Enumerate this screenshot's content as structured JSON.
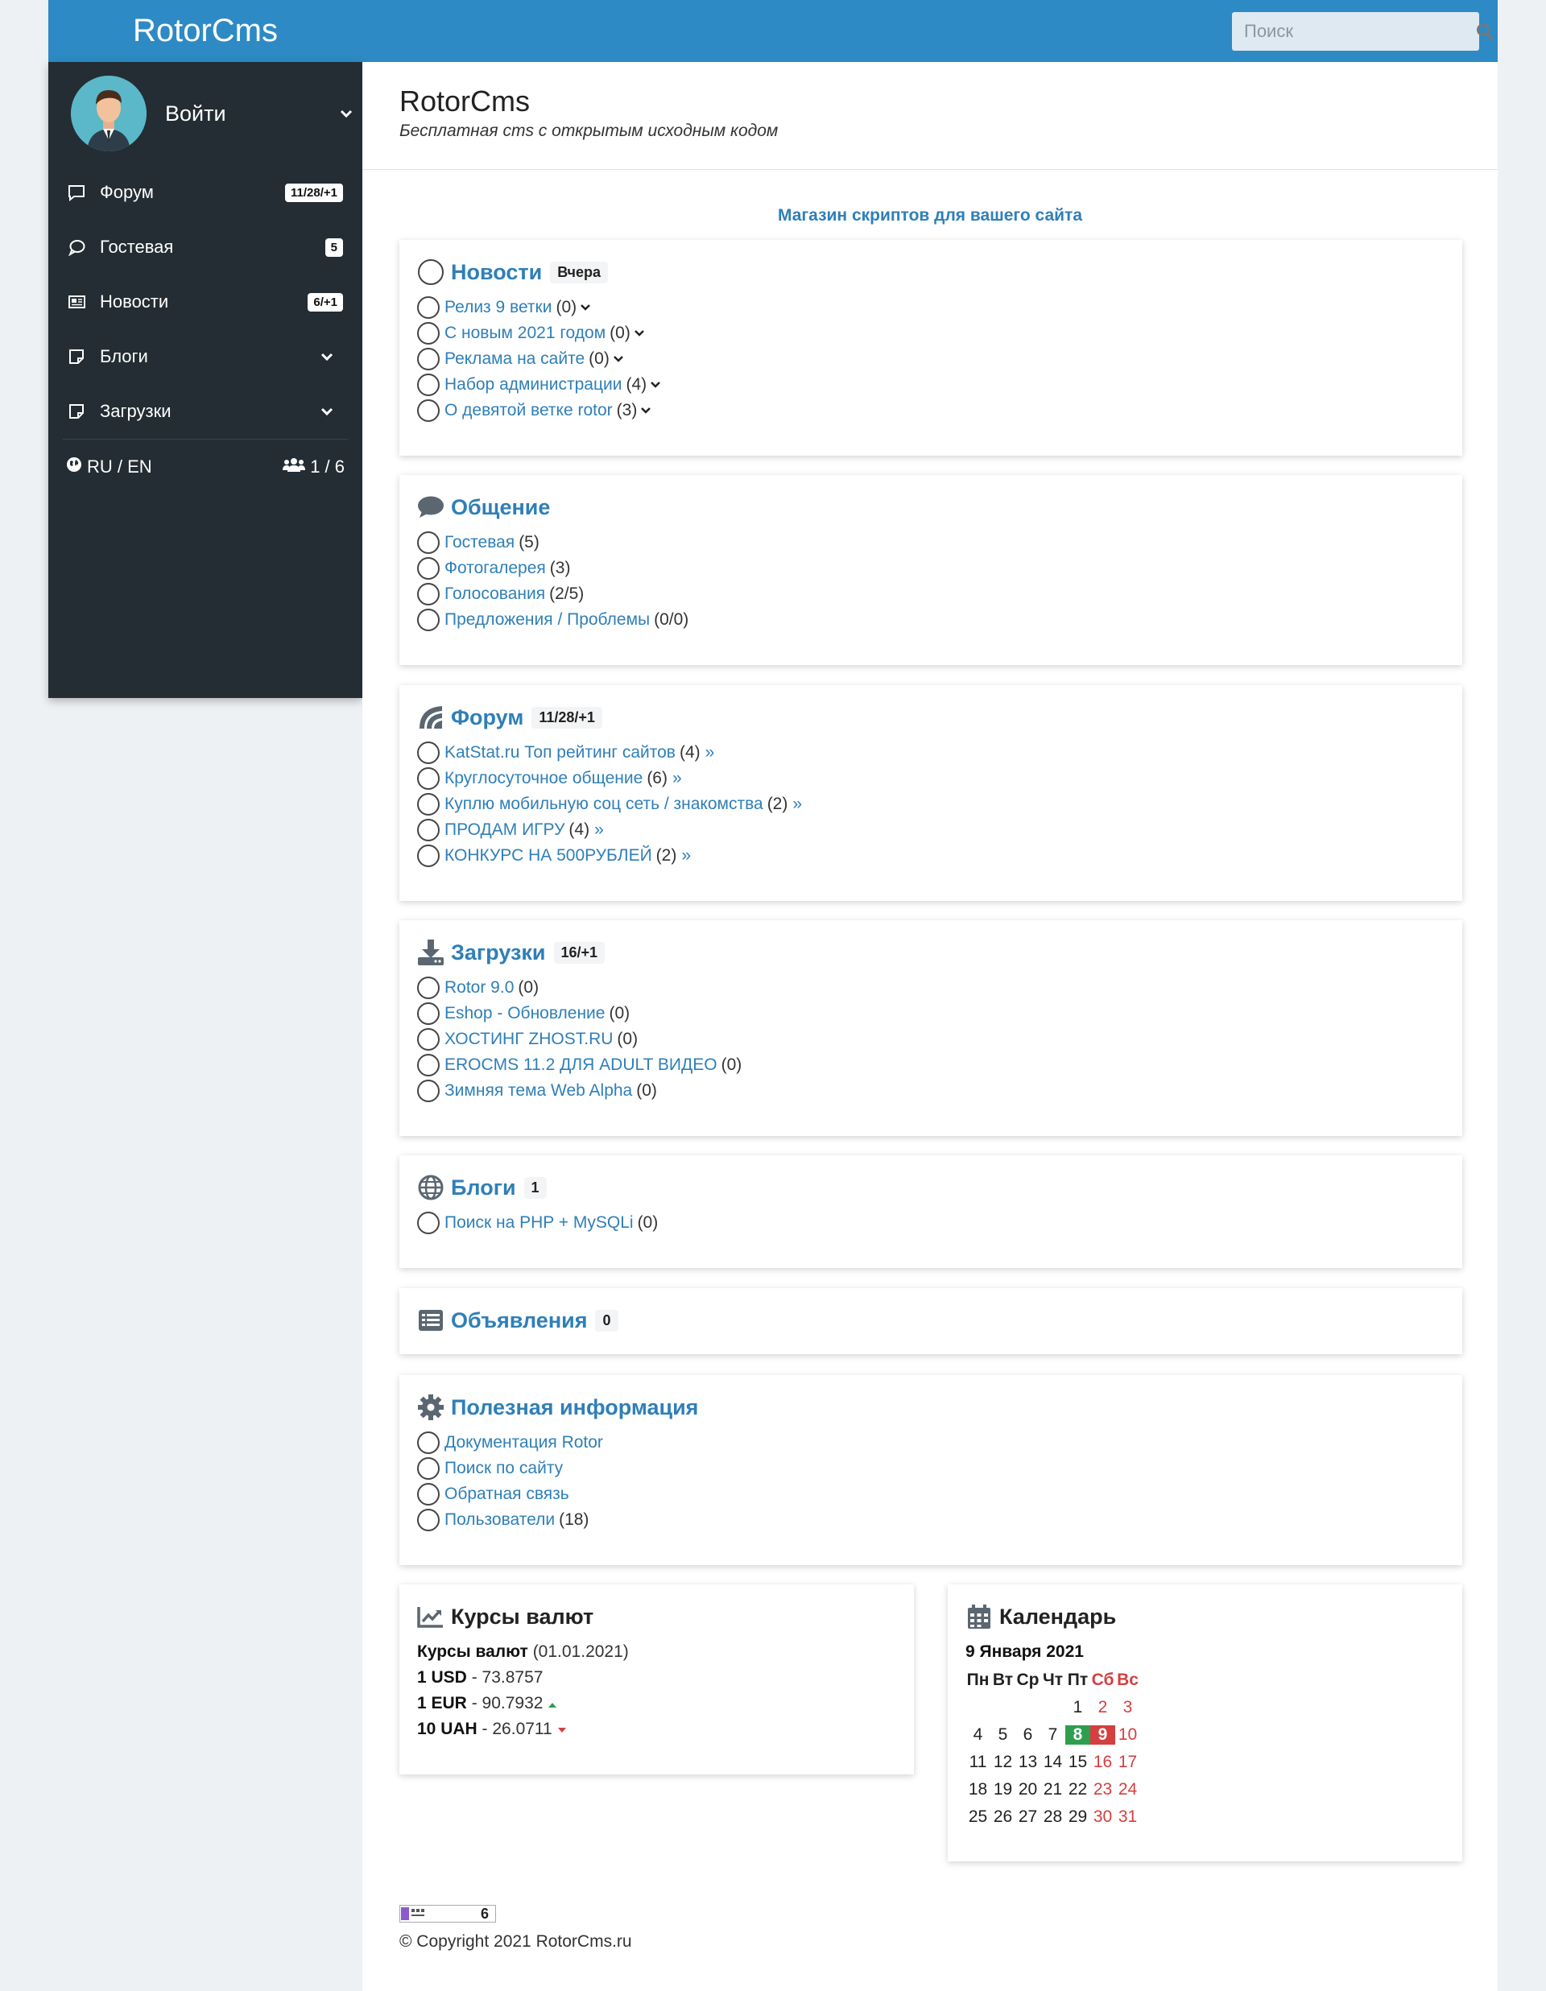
{
  "brand": "RotorCms",
  "search": {
    "placeholder": "Поиск"
  },
  "sidebar": {
    "login_label": "Войти",
    "items": [
      {
        "label": "Форум",
        "badge": "11/28/+1",
        "icon": "comment-square-icon"
      },
      {
        "label": "Гостевая",
        "badge": "5",
        "icon": "comment-round-icon"
      },
      {
        "label": "Новости",
        "badge": "6/+1",
        "icon": "newspaper-icon"
      },
      {
        "label": "Блоги",
        "icon": "note-icon"
      },
      {
        "label": "Загрузки",
        "icon": "note-icon"
      }
    ],
    "language": "RU / EN",
    "online": "1 / 6"
  },
  "header": {
    "title": "RotorCms",
    "subtitle": "Бесплатная cms с открытым исходным кодом"
  },
  "promo": "Магазин скриптов для вашего сайта",
  "news": {
    "title": "Новости",
    "badge": "Вчера",
    "items": [
      {
        "label": "Релиз 9 ветки",
        "count": "(0)"
      },
      {
        "label": "С новым 2021 годом",
        "count": "(0)"
      },
      {
        "label": "Реклама на сайте",
        "count": "(0)"
      },
      {
        "label": "Набор администрации",
        "count": "(4)"
      },
      {
        "label": "О девятой ветке rotor",
        "count": "(3)"
      }
    ]
  },
  "communication": {
    "title": "Общение",
    "items": [
      {
        "label": "Гостевая",
        "count": "(5)"
      },
      {
        "label": "Фотогалерея",
        "count": "(3)"
      },
      {
        "label": "Голосования",
        "count": "(2/5)"
      },
      {
        "label": "Предложения / Проблемы",
        "count": "(0/0)"
      }
    ]
  },
  "forum": {
    "title": "Форум",
    "badge": "11/28/+1",
    "items": [
      {
        "label": "KatStat.ru Топ рейтинг сайтов",
        "count": "(4)"
      },
      {
        "label": "Круглосуточное общение",
        "count": "(6)"
      },
      {
        "label": "Куплю мобильную соц сеть / знакомства",
        "count": "(2)"
      },
      {
        "label": "ПРОДАМ ИГРУ",
        "count": "(4)"
      },
      {
        "label": "КОНКУРС НА 500РУБЛЕЙ",
        "count": "(2)"
      }
    ],
    "more": "»"
  },
  "downloads": {
    "title": "Загрузки",
    "badge": "16/+1",
    "items": [
      {
        "label": "Rotor 9.0",
        "count": "(0)"
      },
      {
        "label": "Eshop - Обновление",
        "count": "(0)"
      },
      {
        "label": "ХОСТИНГ ZHOST.RU",
        "count": "(0)"
      },
      {
        "label": "EROCMS 11.2 ДЛЯ ADULT ВИДЕО",
        "count": "(0)"
      },
      {
        "label": "Зимняя тема Web Alpha",
        "count": "(0)"
      }
    ]
  },
  "blogs": {
    "title": "Блоги",
    "badge": "1",
    "items": [
      {
        "label": "Поиск на PHP + MySQLi",
        "count": "(0)"
      }
    ]
  },
  "ads": {
    "title": "Объявления",
    "badge": "0"
  },
  "info": {
    "title": "Полезная информация",
    "items": [
      {
        "label": "Документация Rotor",
        "count": ""
      },
      {
        "label": "Поиск по сайту",
        "count": ""
      },
      {
        "label": "Обратная связь",
        "count": ""
      },
      {
        "label": "Пользователи",
        "count": "(18)"
      }
    ]
  },
  "currency": {
    "title": "Курсы валют",
    "heading": "Курсы валют",
    "date": "(01.01.2021)",
    "rates": [
      {
        "unit": "1 USD",
        "value": "- 73.8757",
        "trend": "none"
      },
      {
        "unit": "1 EUR",
        "value": "- 90.7932",
        "trend": "up"
      },
      {
        "unit": "10 UAH",
        "value": "- 26.0711",
        "trend": "down"
      }
    ],
    "up_color": "#2e9e4e",
    "down_color": "#d43f3f"
  },
  "calendar": {
    "title": "Календарь",
    "month_label": "9 Января 2021",
    "weekdays": [
      "Пн",
      "Вт",
      "Ср",
      "Чт",
      "Пт",
      "Сб",
      "Вс"
    ],
    "weeks": [
      [
        "",
        "",
        "",
        "",
        "1",
        "2",
        "3"
      ],
      [
        "4",
        "5",
        "6",
        "7",
        "8",
        "9",
        "10"
      ],
      [
        "11",
        "12",
        "13",
        "14",
        "15",
        "16",
        "17"
      ],
      [
        "18",
        "19",
        "20",
        "21",
        "22",
        "23",
        "24"
      ],
      [
        "25",
        "26",
        "27",
        "28",
        "29",
        "30",
        "31"
      ]
    ],
    "today": "9",
    "highlight": "8"
  },
  "footer": {
    "copyright": "© Copyright 2021 RotorCms.ru",
    "counter_text": "6"
  },
  "colors": {
    "accent": "#2e8ac4",
    "sidebar": "#232d33",
    "link": "#2f7fb8"
  }
}
